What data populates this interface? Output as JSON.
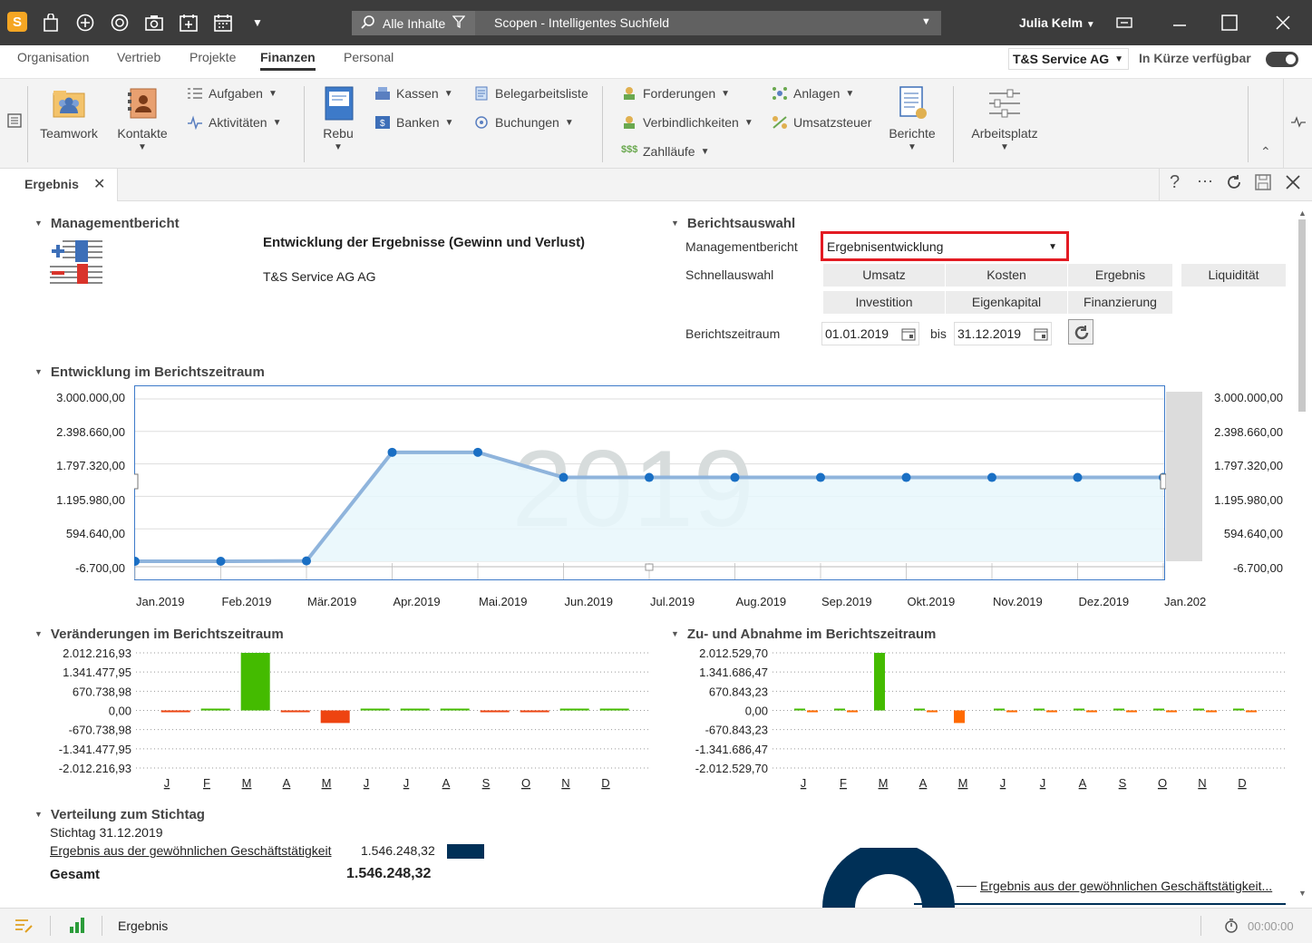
{
  "titlebar": {
    "search_filter": "Alle Inhalte",
    "search_placeholder": "Scopen - Intelligentes Suchfeld",
    "user": "Julia Kelm"
  },
  "nav": {
    "tabs": [
      "Organisation",
      "Vertrieb",
      "Projekte",
      "Finanzen",
      "Personal"
    ],
    "active": "Finanzen",
    "company": "T&S Service AG",
    "soon_label": "In Kürze verfügbar"
  },
  "ribbon": {
    "teamwork": "Teamwork",
    "kontakte": "Kontakte",
    "aufgaben": "Aufgaben",
    "aktivitaeten": "Aktivitäten",
    "rebu": "Rebu",
    "kassen": "Kassen",
    "banken": "Banken",
    "belegarbeitsliste": "Belegarbeitsliste",
    "buchungen": "Buchungen",
    "forderungen": "Forderungen",
    "verbindlichkeiten": "Verbindlichkeiten",
    "zahllaeufe": "Zahlläufe",
    "anlagen": "Anlagen",
    "umsatzsteuer": "Umsatzsteuer",
    "berichte": "Berichte",
    "arbeitsplatz": "Arbeitsplatz"
  },
  "doc_tab": "Ergebnis",
  "report": {
    "section_mgmt": "Managementbericht",
    "title": "Entwicklung der Ergebnisse (Gewinn und Verlust)",
    "company": "T&S Service AG AG",
    "section_select": "Berichtsauswahl",
    "label_mgmt": "Managementbericht",
    "selected_report": "Ergebnisentwicklung",
    "label_quick": "Schnellauswahl",
    "quick": [
      "Umsatz",
      "Kosten",
      "Ergebnis",
      "Liquidität",
      "Investition",
      "Eigenkapital",
      "Finanzierung"
    ],
    "label_period": "Berichtszeitraum",
    "date_from": "01.01.2019",
    "bis": "bis",
    "date_to": "31.12.2019"
  },
  "chart_titles": {
    "development": "Entwicklung im Berichtszeitraum",
    "changes": "Veränderungen im Berichtszeitraum",
    "increase": "Zu- und Abnahme im Berichtszeitraum",
    "distribution": "Verteilung zum Stichtag"
  },
  "chart_data": [
    {
      "type": "area",
      "watermark": "2019",
      "x": [
        "Jan.2019",
        "Feb.2019",
        "Mär.2019",
        "Apr.2019",
        "Mai.2019",
        "Jun.2019",
        "Jul.2019",
        "Aug.2019",
        "Sep.2019",
        "Okt.2019",
        "Nov.2019",
        "Dez.2019",
        "Jan.202"
      ],
      "values": [
        -6700,
        -6700,
        0,
        2012000,
        2012000,
        1546248,
        1546248,
        1546248,
        1546248,
        1546248,
        1546248,
        1546248,
        1546248
      ],
      "yticks": [
        "3.000.000,00",
        "2.398.660,00",
        "1.797.320,00",
        "1.195.980,00",
        "594.640,00",
        "-6.700,00"
      ],
      "ylim": [
        -6700,
        3000000
      ],
      "grid": true,
      "colors": {
        "line": "#8fb4dc",
        "fill": "#e8f7fb",
        "point": "#1a6fc4"
      }
    },
    {
      "type": "bar",
      "categories": [
        "J",
        "F",
        "M",
        "A",
        "M",
        "J",
        "J",
        "A",
        "S",
        "O",
        "N",
        "D"
      ],
      "values": [
        -3000,
        8000,
        2012216.93,
        -3000,
        -440000,
        7000,
        7000,
        7000,
        -3000,
        -3000,
        4000,
        3000
      ],
      "yticks": [
        "2.012.216,93",
        "1.341.477,95",
        "670.738,98",
        "0,00",
        "-670.738,98",
        "-1.341.477,95",
        "-2.012.216,93"
      ],
      "ylim": [
        -2012216.93,
        2012216.93
      ],
      "colors": {
        "positive": "#44bb00",
        "negative": "#ee4411"
      }
    },
    {
      "type": "bar",
      "categories": [
        "J",
        "F",
        "M",
        "A",
        "M",
        "J",
        "J",
        "A",
        "S",
        "O",
        "N",
        "D"
      ],
      "values": [
        5000,
        5000,
        2012529.7,
        5000,
        -440000,
        5000,
        5000,
        5000,
        5000,
        5000,
        5000,
        5000
      ],
      "values_neg": [
        -3000,
        -3000,
        0,
        -3000,
        0,
        -3000,
        -3000,
        -3000,
        -3000,
        -3000,
        -3000,
        -3000
      ],
      "yticks": [
        "2.012.529,70",
        "1.341.686,47",
        "670.843,23",
        "0,00",
        "-670.843,23",
        "-1.341.686,47",
        "-2.012.529,70"
      ],
      "ylim": [
        -2012529.7,
        2012529.7
      ],
      "colors": {
        "positive": "#44bb00",
        "negative": "#ff6a00"
      }
    }
  ],
  "distribution": {
    "stichtag": "Stichtag 31.12.2019",
    "row_label": "Ergebnis aus der gewöhnlichen Geschäftstätigkeit",
    "row_value": "1.546.248,32",
    "total_label": "Gesamt",
    "total_value": "1.546.248,32",
    "donut_label": "Ergebnis aus der gewöhnlichen Geschäftstätigkeit...",
    "color": "#003057"
  },
  "status": {
    "item": "Ergebnis",
    "time": "00:00:00"
  }
}
